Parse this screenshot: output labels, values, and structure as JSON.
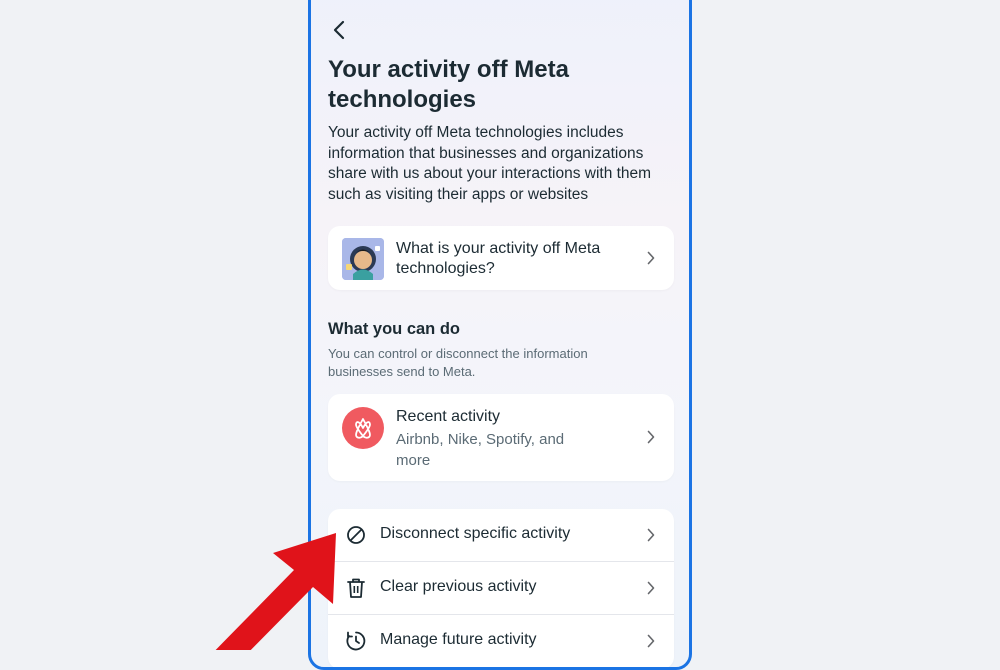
{
  "header": {
    "back_icon": "chevron-left-icon",
    "title": "Your activity off Meta technologies",
    "description": "Your activity off Meta technologies includes information that businesses and organizations share with us about your interactions with them such as visiting their apps or websites"
  },
  "info_card": {
    "label": "What is your activity off Meta technologies?",
    "icon": "illustration-thumbnail"
  },
  "section": {
    "title": "What you can do",
    "subtitle": "You can control or disconnect the information businesses send to Meta."
  },
  "recent_card": {
    "title": "Recent activity",
    "subtitle": "Airbnb, Nike, Spotify, and more",
    "icon": "airbnb-logo-icon",
    "icon_color": "#f05a60"
  },
  "actions": [
    {
      "label": "Disconnect specific activity",
      "icon": "block-icon"
    },
    {
      "label": "Clear previous activity",
      "icon": "trash-icon"
    },
    {
      "label": "Manage future activity",
      "icon": "history-clock-icon"
    }
  ],
  "colors": {
    "frame_border": "#1b74e4",
    "annotation_arrow": "#e0131a"
  }
}
